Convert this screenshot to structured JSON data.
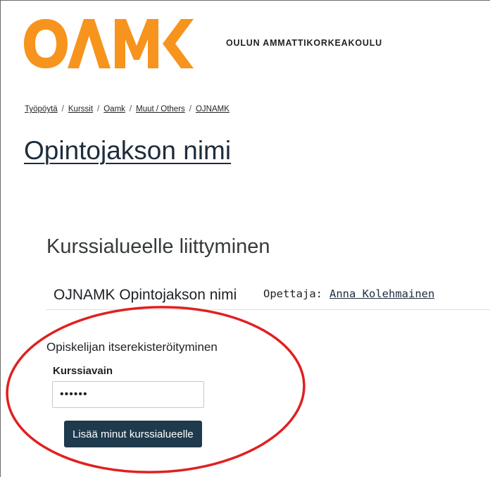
{
  "header": {
    "logo_alt": "OAMK",
    "school_name": "OULUN AMMATTIKORKEAKOULU",
    "brand_color": "#f7941d"
  },
  "breadcrumb": {
    "items": [
      "Työpöytä",
      "Kurssit",
      "Oamk",
      "Muut / Others",
      "OJNAMK"
    ],
    "separator": "/"
  },
  "page": {
    "title": "Opintojakson nimi"
  },
  "enrolment": {
    "heading": "Kurssialueelle liittyminen",
    "course_name": "OJNAMK Opintojakson nimi",
    "teacher_label": "Opettaja:",
    "teacher_name": "Anna Kolehmainen",
    "method_title": "Opiskelijan itserekisteröityminen",
    "key_label": "Kurssiavain",
    "key_value": "••••••",
    "submit_label": "Lisää minut kurssialueelle",
    "button_color": "#1e3a4c"
  },
  "annotation": {
    "shape": "ellipse",
    "color": "#e02020"
  }
}
